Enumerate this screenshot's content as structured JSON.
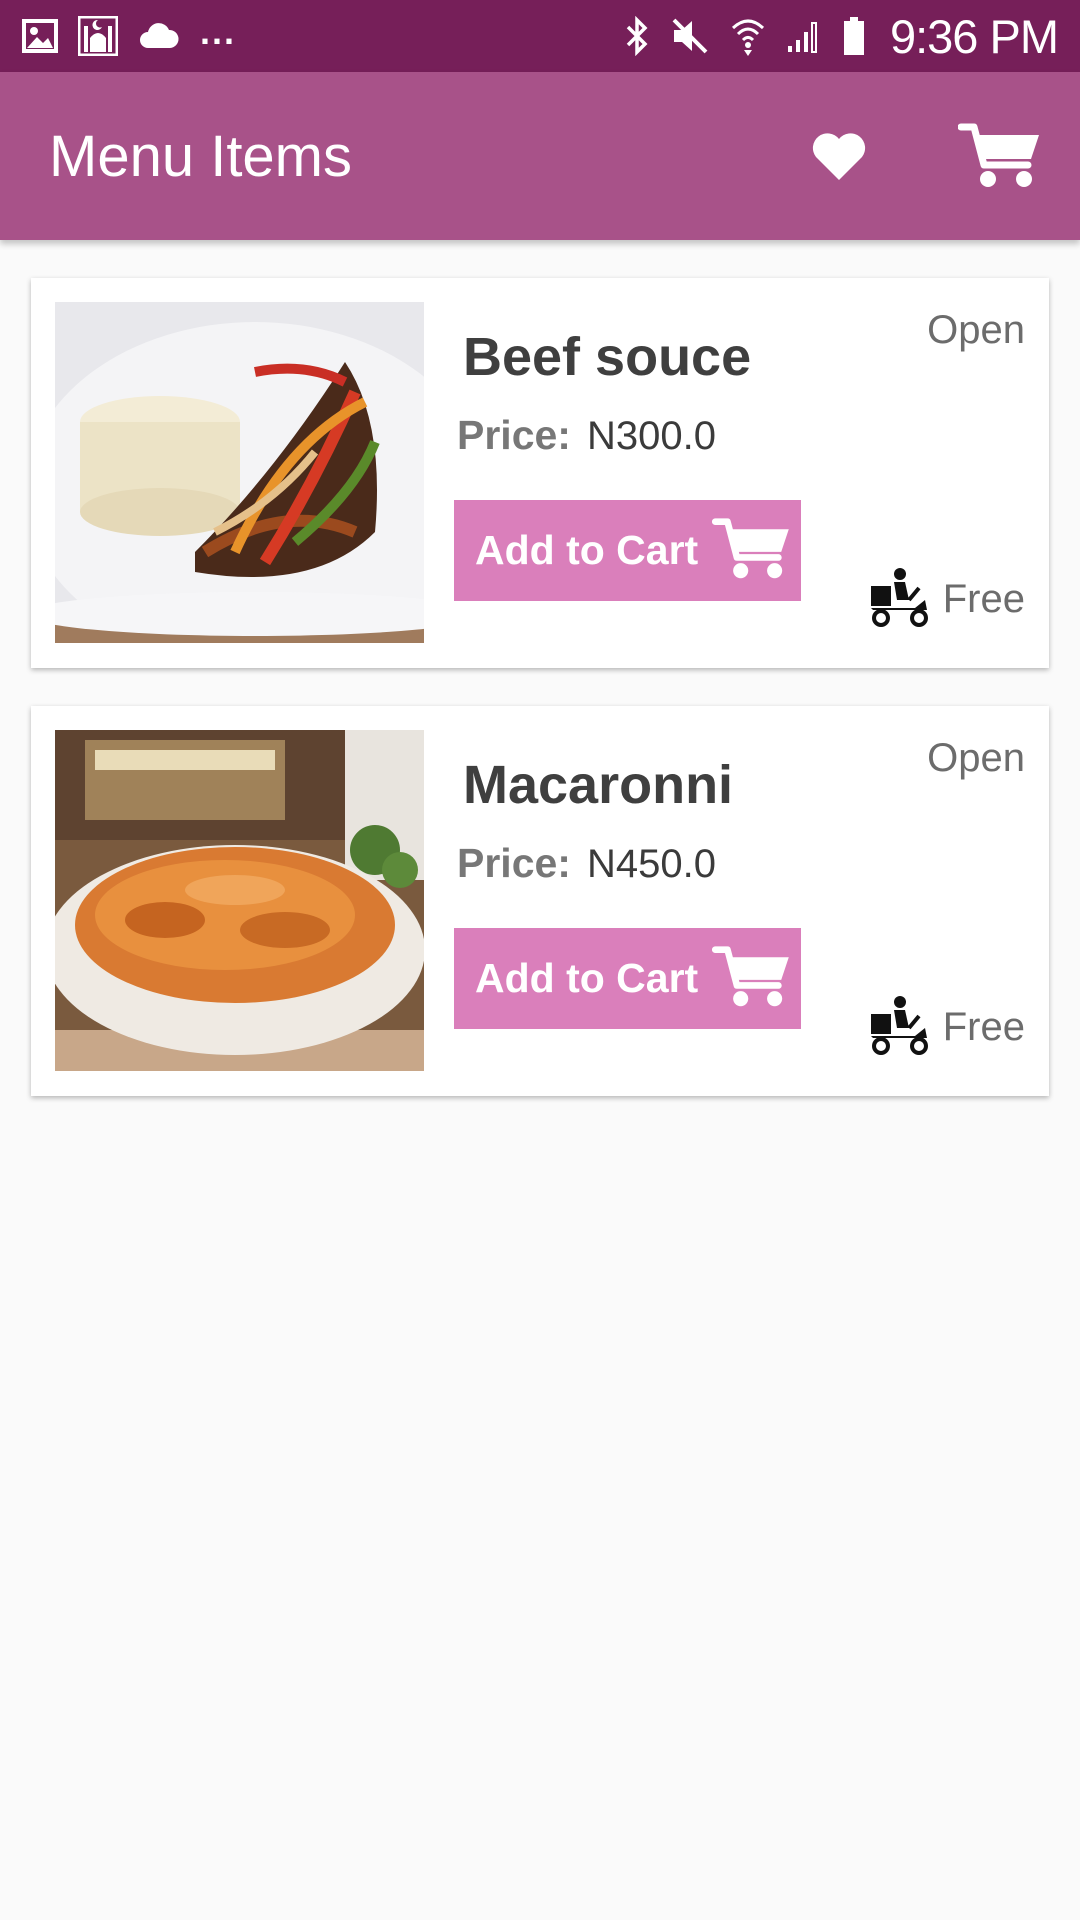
{
  "status_bar": {
    "time": "9:36 PM",
    "overflow": "...",
    "icons": [
      "gallery-icon",
      "mosque-icon",
      "cloud-icon",
      "bluetooth-icon",
      "mute-icon",
      "wifi-icon",
      "signal-icon",
      "battery-icon"
    ]
  },
  "app_bar": {
    "title": "Menu Items",
    "icons": [
      "heart-icon",
      "cart-icon"
    ]
  },
  "colors": {
    "status_bar": "#761f59",
    "app_bar": "#a85289",
    "button": "#da7fbb",
    "background": "#fafafa"
  },
  "menu_items": [
    {
      "name": "Beef souce",
      "price_label": "Price:",
      "price": "N300.0",
      "button_label": "Add to Cart",
      "status": "Open",
      "delivery": "Free"
    },
    {
      "name": "Macaronni",
      "price_label": "Price:",
      "price": "N450.0",
      "button_label": "Add to Cart",
      "status": "Open",
      "delivery": "Free"
    }
  ]
}
